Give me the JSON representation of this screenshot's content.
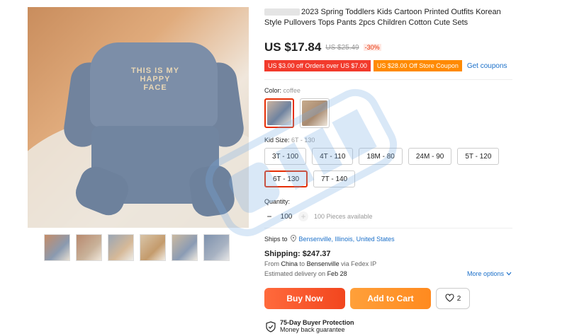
{
  "product": {
    "title": "2023 Spring Toddlers Kids Cartoon Printed Outfits Korean Style Pullovers Tops Pants 2pcs Children Cotton Cute Sets",
    "price": "US $17.84",
    "old_price": "US $25.49",
    "discount": "-30%",
    "main_image_print": "THIS IS MY HAPPY FACE"
  },
  "coupons": {
    "orders_coupon": "US $3.00 off Orders over US $7.00",
    "store_coupon": "US $28.00 Off Store Coupon",
    "get_coupons": "Get coupons"
  },
  "color": {
    "label": "Color:",
    "selected": "coffee"
  },
  "size": {
    "label": "Kid Size:",
    "selected": "6T - 130",
    "options": [
      "3T - 100",
      "4T - 110",
      "18M - 80",
      "24M - 90",
      "5T - 120",
      "6T - 130",
      "7T - 140"
    ]
  },
  "quantity": {
    "label": "Quantity:",
    "minus": "−",
    "value": "100",
    "plus": "+",
    "available": "100 Pieces available"
  },
  "shipping": {
    "ships_to_label": "Ships to",
    "ships_to": "Bensenville, Illinois, United States",
    "cost": "Shipping: $247.37",
    "from_prefix": "From",
    "from": "China",
    "to_prefix": "to",
    "to": "Bensenville",
    "via": "via Fedex IP",
    "eta_prefix": "Estimated delivery on",
    "eta": "Feb 28",
    "more_options": "More options"
  },
  "actions": {
    "buy_now": "Buy Now",
    "add_to_cart": "Add to Cart",
    "wishlist_count": "2"
  },
  "protection": {
    "title": "75-Day Buyer Protection",
    "subtitle": "Money back guarantee"
  },
  "icons": {
    "pin": "location-pin-icon",
    "heart": "heart-icon",
    "shield": "shield-check-icon",
    "chevron": "chevron-down-icon"
  },
  "colors": {
    "price_red": "#e62e04",
    "coupon_red": "#f23a2c",
    "coupon_orange": "#ff8a00",
    "link_blue": "#1a6fc9",
    "buy_button": "#f2461e",
    "cart_button": "#ff8a1f"
  }
}
